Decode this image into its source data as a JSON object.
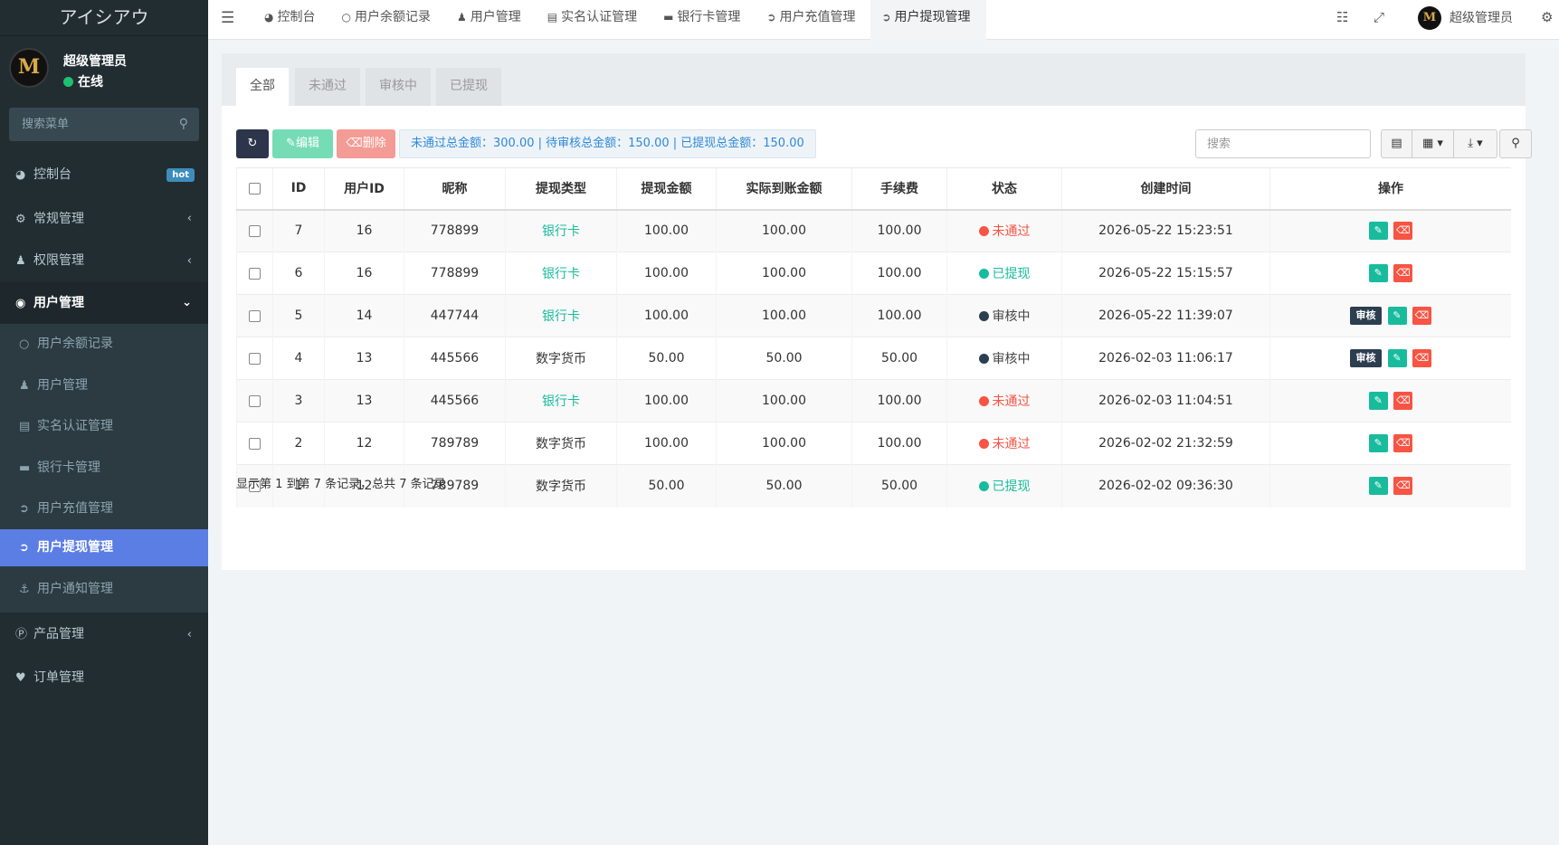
{
  "brand": "アイシアウ",
  "user": {
    "avatar_letter": "M",
    "name": "超级管理员",
    "status": "在线"
  },
  "sidebar_search_placeholder": "搜索菜单",
  "menu": {
    "dashboard": "控制台",
    "hot_badge": "hot",
    "general": "常规管理",
    "permission": "权限管理",
    "users": "用户管理",
    "sub": {
      "balance": "用户余额记录",
      "user_mgmt": "用户管理",
      "realname": "实名认证管理",
      "bankcard": "银行卡管理",
      "recharge": "用户充值管理",
      "withdraw": "用户提现管理",
      "notice": "用户通知管理"
    },
    "product": "产品管理",
    "order": "订单管理"
  },
  "navtabs": {
    "dashboard": "控制台",
    "balance": "用户余额记录",
    "user_mgmt": "用户管理",
    "realname": "实名认证管理",
    "bankcard": "银行卡管理",
    "recharge": "用户充值管理",
    "withdraw": "用户提现管理"
  },
  "nav_user": "超级管理员",
  "filter_tabs": {
    "all": "全部",
    "rejected": "未通过",
    "reviewing": "审核中",
    "withdrawn": "已提现"
  },
  "toolbar": {
    "edit": "编辑",
    "delete": "删除",
    "summary": "未通过总金额：300.00 | 待审核总金额：150.00 | 已提现总金额：150.00",
    "search_placeholder": "搜索"
  },
  "table": {
    "headers": {
      "id": "ID",
      "uid": "用户ID",
      "nick": "昵称",
      "type": "提现类型",
      "amount": "提现金额",
      "actual": "实际到账金额",
      "fee": "手续费",
      "status": "状态",
      "created": "创建时间",
      "ops": "操作"
    },
    "audit_label": "审核",
    "rows": [
      {
        "id": "7",
        "uid": "16",
        "nick": "778899",
        "type": "银行卡",
        "amount": "100.00",
        "actual": "100.00",
        "fee": "100.00",
        "status": "未通过",
        "created": "2026-05-22 15:23:51"
      },
      {
        "id": "6",
        "uid": "16",
        "nick": "778899",
        "type": "银行卡",
        "amount": "100.00",
        "actual": "100.00",
        "fee": "100.00",
        "status": "已提现",
        "created": "2026-05-22 15:15:57"
      },
      {
        "id": "5",
        "uid": "14",
        "nick": "447744",
        "type": "银行卡",
        "amount": "100.00",
        "actual": "100.00",
        "fee": "100.00",
        "status": "审核中",
        "created": "2026-05-22 11:39:07"
      },
      {
        "id": "4",
        "uid": "13",
        "nick": "445566",
        "type": "数字货币",
        "amount": "50.00",
        "actual": "50.00",
        "fee": "50.00",
        "status": "审核中",
        "created": "2026-02-03 11:06:17"
      },
      {
        "id": "3",
        "uid": "13",
        "nick": "445566",
        "type": "银行卡",
        "amount": "100.00",
        "actual": "100.00",
        "fee": "100.00",
        "status": "未通过",
        "created": "2026-02-03 11:04:51"
      },
      {
        "id": "2",
        "uid": "12",
        "nick": "789789",
        "type": "数字货币",
        "amount": "100.00",
        "actual": "100.00",
        "fee": "100.00",
        "status": "未通过",
        "created": "2026-02-02 21:32:59"
      },
      {
        "id": "1",
        "uid": "12",
        "nick": "789789",
        "type": "数字货币",
        "amount": "50.00",
        "actual": "50.00",
        "fee": "50.00",
        "status": "已提现",
        "created": "2026-02-02 09:36:30"
      }
    ]
  },
  "footer": "显示第 1 到第 7 条记录，总共 7 条记录",
  "colors": {
    "sidebar_bg": "#222d32",
    "active_menu": "#5b7ee5",
    "success": "#18bc9c",
    "danger": "#f75444",
    "dark": "#2c3e50"
  }
}
